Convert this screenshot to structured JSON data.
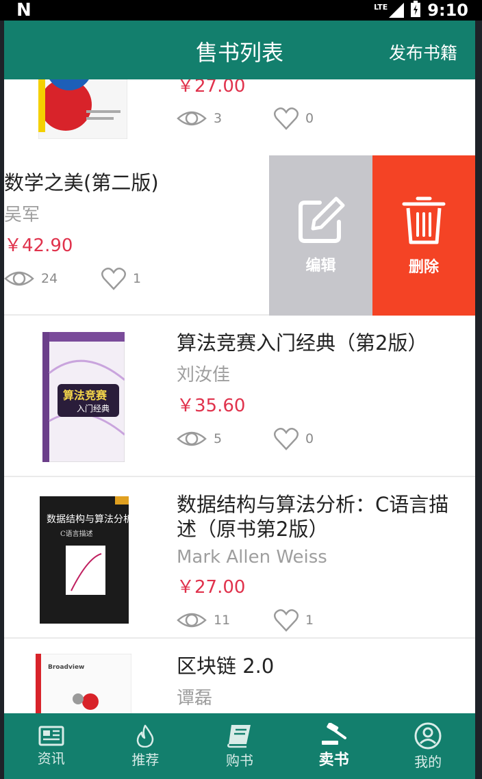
{
  "status_bar": {
    "network": "LTE",
    "time": "9:10"
  },
  "app_bar": {
    "title": "售书列表",
    "action": "发布书籍"
  },
  "books": [
    {
      "title": "",
      "author": "",
      "price": "￥27.00",
      "views": "3",
      "likes": "0"
    },
    {
      "title": "数学之美(第二版)",
      "author": "吴军",
      "price": "￥42.90",
      "views": "24",
      "likes": "1"
    },
    {
      "title": "算法竞赛入门经典（第2版）",
      "author": "刘汝佳",
      "price": "￥35.60",
      "views": "5",
      "likes": "0"
    },
    {
      "title": "数据结构与算法分析：C语言描述（原书第2版）",
      "author": "Mark Allen Weiss",
      "price": "￥27.00",
      "views": "11",
      "likes": "1"
    },
    {
      "title": "区块链 2.0",
      "author": "谭磊",
      "price": "",
      "views": "",
      "likes": ""
    }
  ],
  "swipe_actions": {
    "edit": "编辑",
    "delete": "删除"
  },
  "nav": [
    {
      "label": "资讯",
      "icon": "newspaper-icon"
    },
    {
      "label": "推荐",
      "icon": "flame-icon"
    },
    {
      "label": "购书",
      "icon": "book-icon"
    },
    {
      "label": "卖书",
      "icon": "gavel-icon",
      "active": true
    },
    {
      "label": "我的",
      "icon": "user-icon"
    }
  ],
  "colors": {
    "primary": "#137f6d",
    "price": "#e0324c",
    "edit": "#c6c6cb",
    "delete": "#f44325"
  }
}
